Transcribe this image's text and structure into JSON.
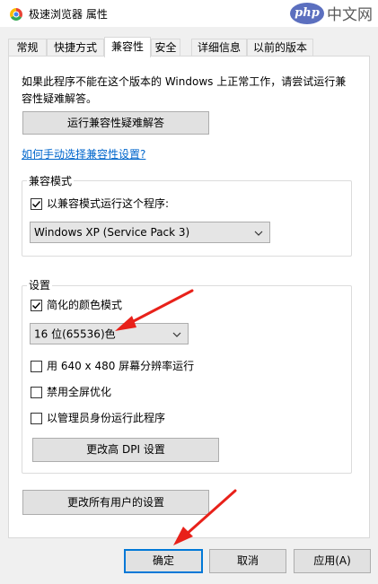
{
  "window": {
    "title": "极速浏览器 属性"
  },
  "watermark": {
    "logo": "php",
    "text": "中文网"
  },
  "tabs": [
    {
      "label": "常规"
    },
    {
      "label": "快捷方式"
    },
    {
      "label": "兼容性"
    },
    {
      "label": "安全"
    },
    {
      "label": "详细信息"
    },
    {
      "label": "以前的版本"
    }
  ],
  "compat": {
    "description": "如果此程序不能在这个版本的 Windows 上正常工作，请尝试运行兼容性疑难解答。",
    "troubleshoot_button": "运行兼容性疑难解答",
    "manual_link": "如何手动选择兼容性设置?",
    "mode_group": "兼容模式",
    "mode_checkbox": "以兼容模式运行这个程序:",
    "mode_checked": true,
    "os_select": "Windows XP (Service Pack 3)"
  },
  "settings": {
    "group": "设置",
    "reduced_color": {
      "label": "简化的颜色模式",
      "checked": true
    },
    "color_select": "16 位(65536)色",
    "res_640": {
      "label": "用 640 x 480 屏幕分辨率运行",
      "checked": false
    },
    "disable_fullscreen": {
      "label": "禁用全屏优化",
      "checked": false
    },
    "run_as_admin": {
      "label": "以管理员身份运行此程序",
      "checked": false
    },
    "dpi_button": "更改高 DPI 设置"
  },
  "all_users_button": "更改所有用户的设置",
  "footer": {
    "ok": "确定",
    "cancel": "取消",
    "apply": "应用(A)"
  },
  "colors": {
    "accent": "#0078d7",
    "arrow": "#e8211a",
    "link": "#0066cc"
  }
}
